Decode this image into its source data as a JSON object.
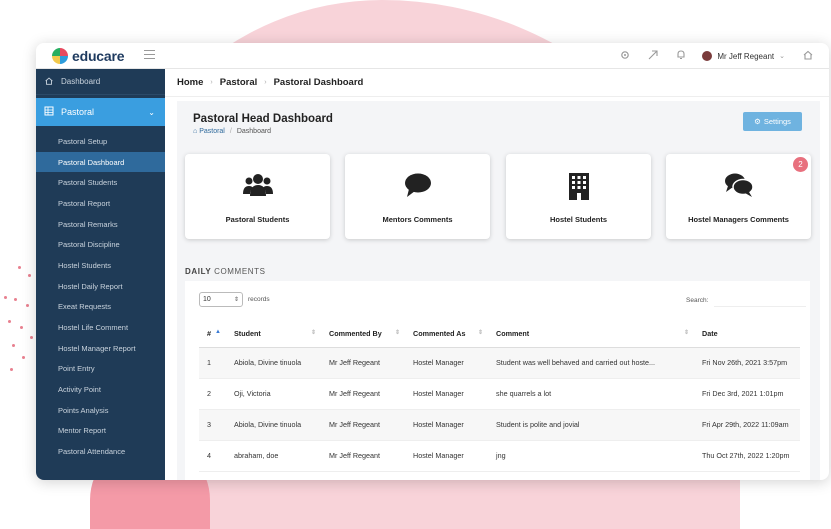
{
  "app": {
    "logo_text": "educare",
    "user_name": "Mr Jeff Regeant"
  },
  "topbar_icons": [
    "gear-icon",
    "rocket-icon",
    "bell-icon",
    "home-icon"
  ],
  "sidebar": {
    "dashboard_label": "Dashboard",
    "section_label": "Pastoral",
    "items": [
      {
        "label": "Pastoral Setup"
      },
      {
        "label": "Pastoral Dashboard",
        "active": true
      },
      {
        "label": "Pastoral Students"
      },
      {
        "label": "Pastoral Report"
      },
      {
        "label": "Pastoral Remarks"
      },
      {
        "label": "Pastoral Discipline"
      },
      {
        "label": "Hostel Students"
      },
      {
        "label": "Hostel Daily Report"
      },
      {
        "label": "Exeat Requests"
      },
      {
        "label": "Hostel Life Comment"
      },
      {
        "label": "Hostel Manager Report"
      },
      {
        "label": "Point Entry"
      },
      {
        "label": "Activity Point"
      },
      {
        "label": "Points Analysis"
      },
      {
        "label": "Mentor Report"
      },
      {
        "label": "Pastoral Attendance"
      }
    ]
  },
  "breadcrumb": {
    "items": [
      "Home",
      "Pastoral",
      "Pastoral Dashboard"
    ]
  },
  "header": {
    "title": "Pastoral Head Dashboard",
    "crumb_home": "Pastoral",
    "crumb_current": "Dashboard",
    "settings_label": "Settings"
  },
  "cards": [
    {
      "label": "Pastoral Students",
      "icon": "users-icon"
    },
    {
      "label": "Mentors Comments",
      "icon": "comment-icon"
    },
    {
      "label": "Hostel Students",
      "icon": "building-icon"
    },
    {
      "label": "Hostel Managers Comments",
      "icon": "comments-icon",
      "badge": "2"
    }
  ],
  "daily": {
    "title_bold": "DAILY",
    "title_rest": " COMMENTS",
    "page_length": "10",
    "length_label": "records",
    "search_label": "Search:"
  },
  "table": {
    "columns": [
      "#",
      "Student",
      "Commented By",
      "Commented As",
      "Comment",
      "Date"
    ],
    "rows": [
      [
        "1",
        "Abiola, Divine tinuola",
        "Mr Jeff Regeant",
        "Hostel Manager",
        "Student was well behaved and carried out hoste...",
        "Fri Nov 26th, 2021 3:57pm"
      ],
      [
        "2",
        "Oji, Victoria",
        "Mr Jeff Regeant",
        "Hostel Manager",
        "she quarrels a lot",
        "Fri Dec 3rd, 2021 1:01pm"
      ],
      [
        "3",
        "Abiola, Divine tinuola",
        "Mr Jeff Regeant",
        "Hostel Manager",
        "Student is polite and jovial",
        "Fri Apr 29th, 2022 11:09am"
      ],
      [
        "4",
        "abraham, doe",
        "Mr Jeff Regeant",
        "Hostel Manager",
        "jng",
        "Thu Oct 27th, 2022 1:20pm"
      ]
    ]
  },
  "colors": {
    "sidebar_bg": "#1f3b57",
    "accent": "#3a9ee0",
    "active_item": "#2f6a9c",
    "badge": "#e8707e",
    "background_blob": "#f8d3d9"
  }
}
